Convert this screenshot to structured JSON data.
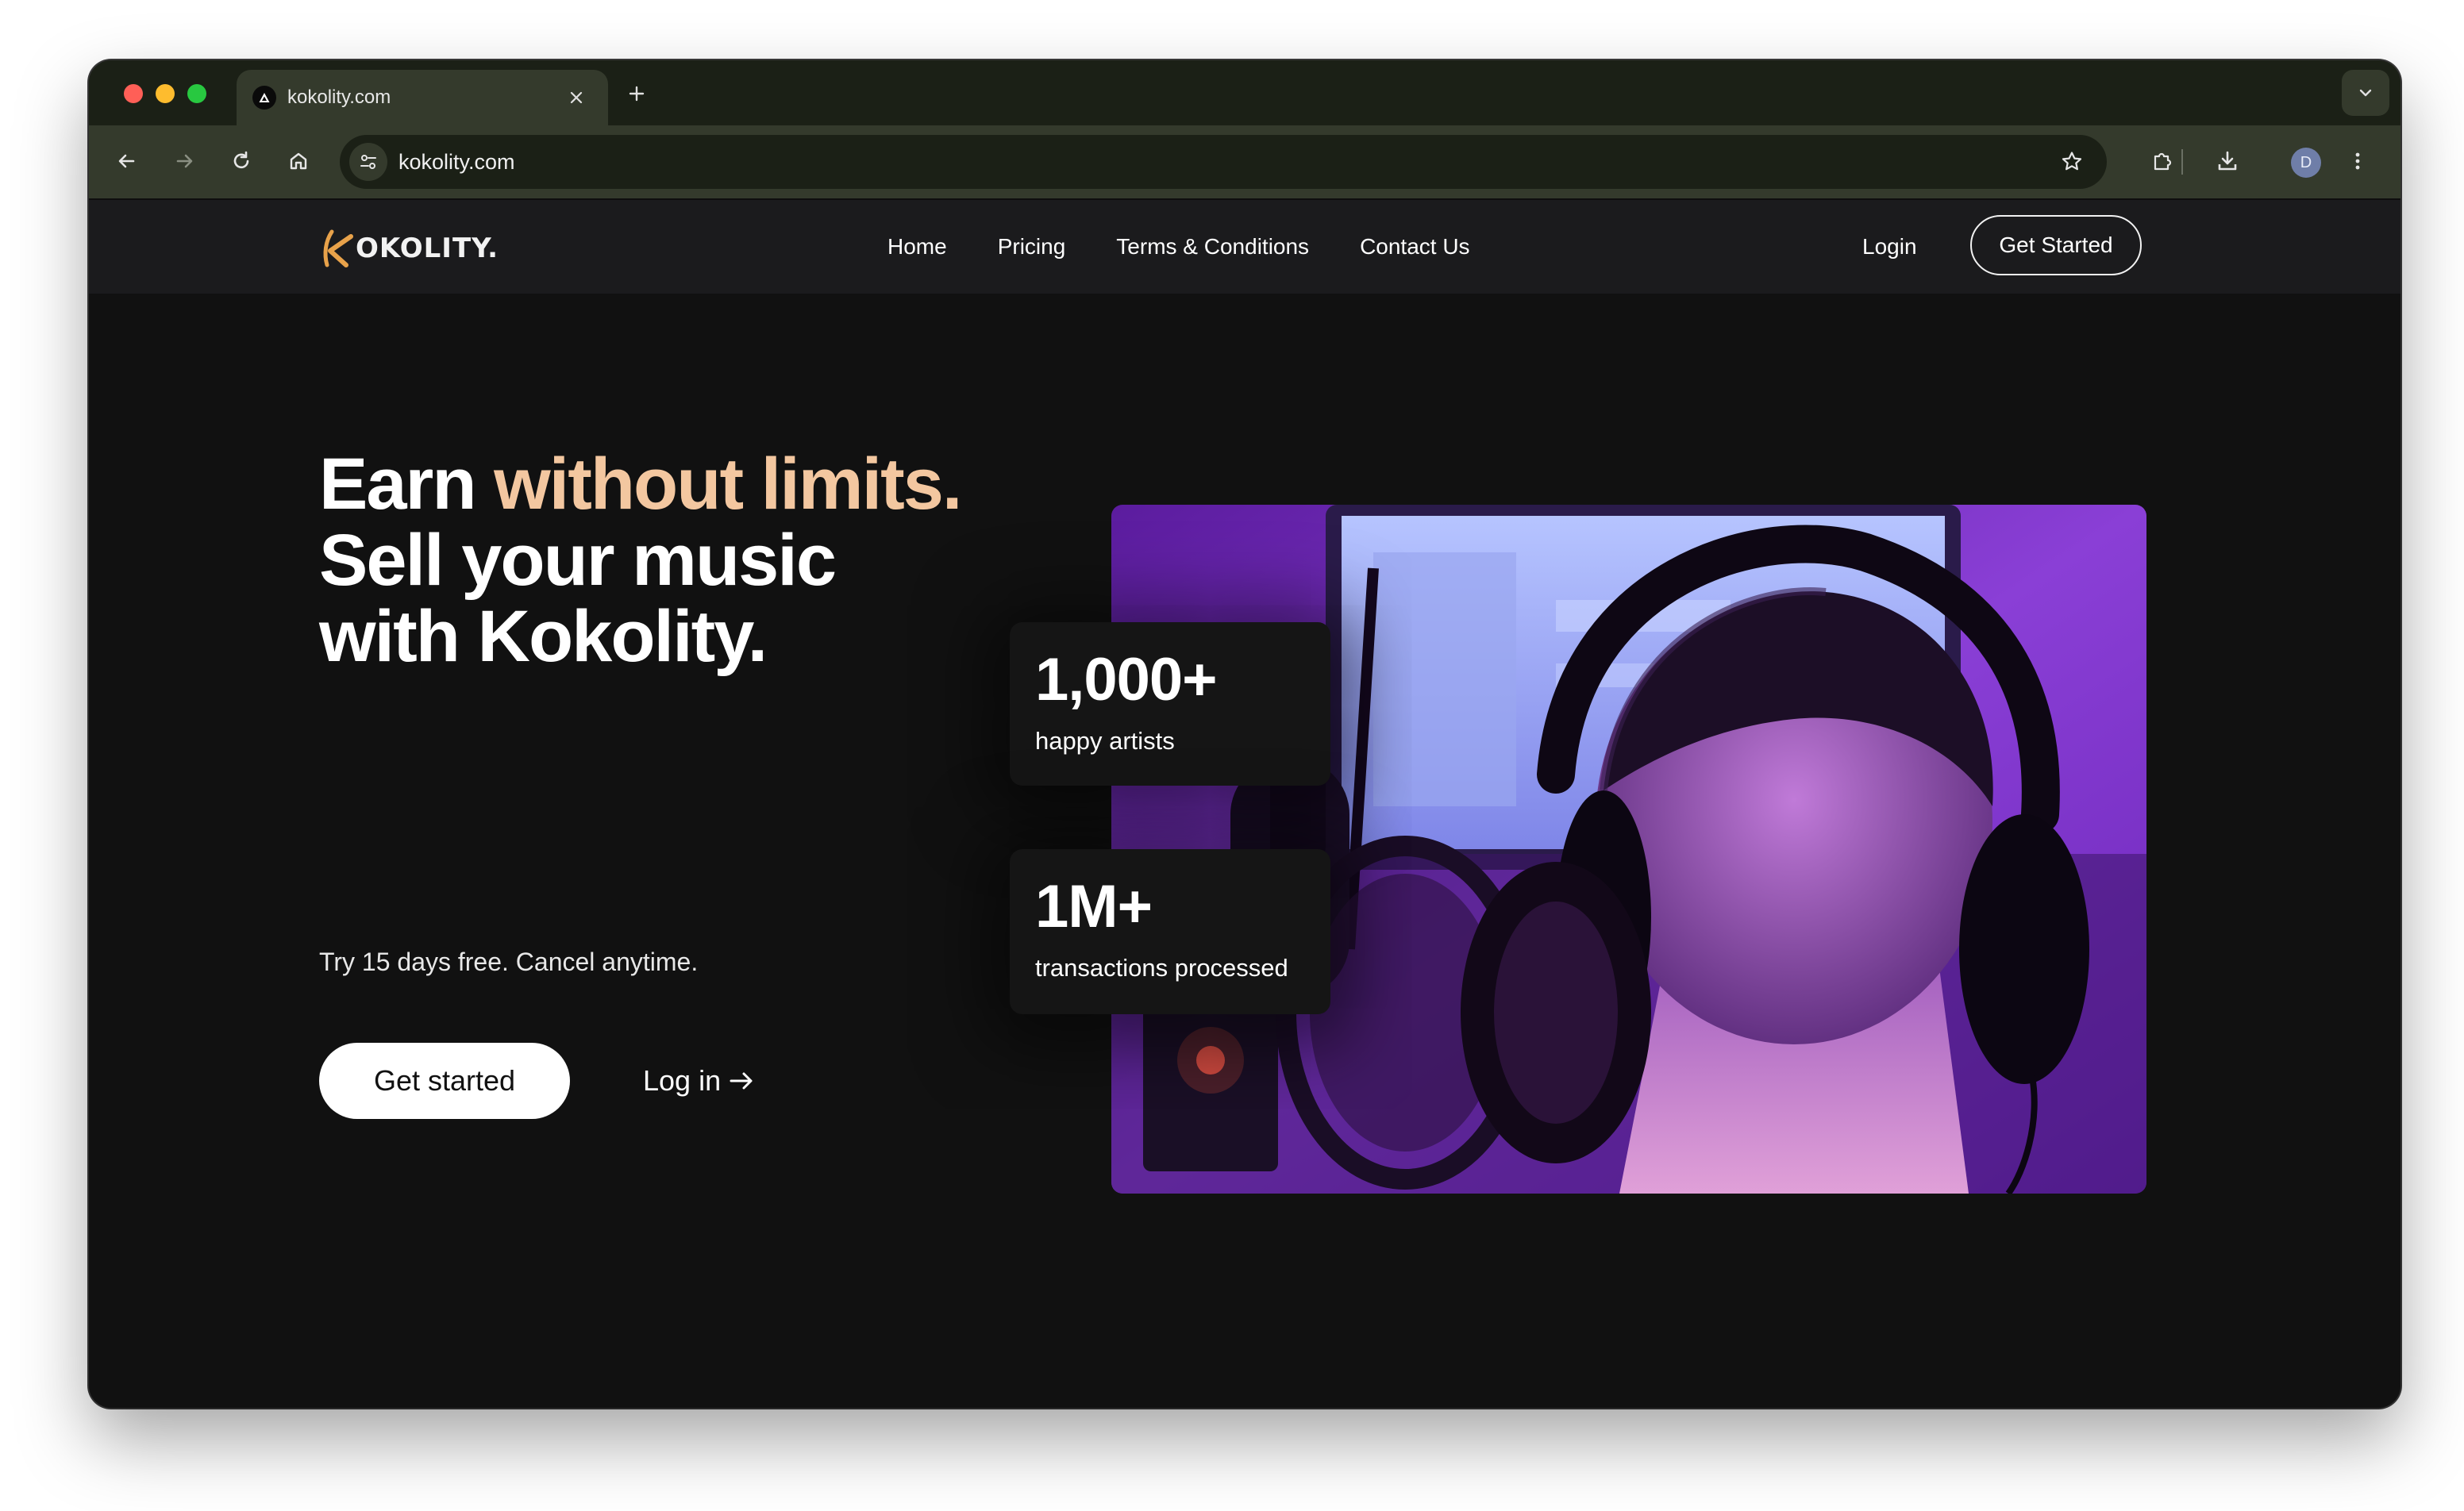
{
  "browser": {
    "tab_title": "kokolity.com",
    "url": "kokolity.com",
    "profile_initial": "D",
    "icons": [
      "favicon-triangle-icon",
      "close-icon",
      "plus-icon",
      "chevron-down-icon",
      "back-arrow-icon",
      "forward-arrow-icon",
      "reload-icon",
      "home-icon",
      "site-settings-icon",
      "star-icon",
      "extensions-puzzle-icon",
      "download-icon",
      "kebab-menu-icon"
    ]
  },
  "site": {
    "logo_text": "OKOLITY.",
    "nav": {
      "links": [
        "Home",
        "Pricing",
        "Terms & Conditions",
        "Contact Us"
      ],
      "login": "Login",
      "cta": "Get Started"
    },
    "hero": {
      "title_part1": "Earn ",
      "title_accent": "without limits.",
      "title_part2": "Sell your music with Kokolity.",
      "subtitle": "Try 15 days free. Cancel anytime.",
      "primary_button": "Get started",
      "secondary_link": "Log in"
    },
    "stats": [
      {
        "value": "1,000+",
        "label": "happy artists"
      },
      {
        "value": "1M+",
        "label": "transactions processed"
      }
    ],
    "colors": {
      "accent": "#f3c7a0",
      "logo_k": "#e8a24a",
      "background": "#111111",
      "photo_tint": "#7a2fd0"
    }
  }
}
